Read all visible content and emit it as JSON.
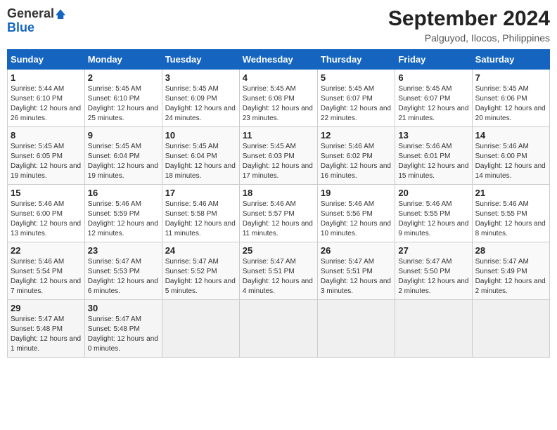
{
  "header": {
    "logo_line1": "General",
    "logo_line2": "Blue",
    "title": "September 2024",
    "subtitle": "Palguyod, Ilocos, Philippines"
  },
  "weekdays": [
    "Sunday",
    "Monday",
    "Tuesday",
    "Wednesday",
    "Thursday",
    "Friday",
    "Saturday"
  ],
  "weeks": [
    [
      {
        "day": "1",
        "sunrise": "5:44 AM",
        "sunset": "6:10 PM",
        "daylight": "12 hours and 26 minutes."
      },
      {
        "day": "2",
        "sunrise": "5:45 AM",
        "sunset": "6:10 PM",
        "daylight": "12 hours and 25 minutes."
      },
      {
        "day": "3",
        "sunrise": "5:45 AM",
        "sunset": "6:09 PM",
        "daylight": "12 hours and 24 minutes."
      },
      {
        "day": "4",
        "sunrise": "5:45 AM",
        "sunset": "6:08 PM",
        "daylight": "12 hours and 23 minutes."
      },
      {
        "day": "5",
        "sunrise": "5:45 AM",
        "sunset": "6:07 PM",
        "daylight": "12 hours and 22 minutes."
      },
      {
        "day": "6",
        "sunrise": "5:45 AM",
        "sunset": "6:07 PM",
        "daylight": "12 hours and 21 minutes."
      },
      {
        "day": "7",
        "sunrise": "5:45 AM",
        "sunset": "6:06 PM",
        "daylight": "12 hours and 20 minutes."
      }
    ],
    [
      {
        "day": "8",
        "sunrise": "5:45 AM",
        "sunset": "6:05 PM",
        "daylight": "12 hours and 19 minutes."
      },
      {
        "day": "9",
        "sunrise": "5:45 AM",
        "sunset": "6:04 PM",
        "daylight": "12 hours and 19 minutes."
      },
      {
        "day": "10",
        "sunrise": "5:45 AM",
        "sunset": "6:04 PM",
        "daylight": "12 hours and 18 minutes."
      },
      {
        "day": "11",
        "sunrise": "5:45 AM",
        "sunset": "6:03 PM",
        "daylight": "12 hours and 17 minutes."
      },
      {
        "day": "12",
        "sunrise": "5:46 AM",
        "sunset": "6:02 PM",
        "daylight": "12 hours and 16 minutes."
      },
      {
        "day": "13",
        "sunrise": "5:46 AM",
        "sunset": "6:01 PM",
        "daylight": "12 hours and 15 minutes."
      },
      {
        "day": "14",
        "sunrise": "5:46 AM",
        "sunset": "6:00 PM",
        "daylight": "12 hours and 14 minutes."
      }
    ],
    [
      {
        "day": "15",
        "sunrise": "5:46 AM",
        "sunset": "6:00 PM",
        "daylight": "12 hours and 13 minutes."
      },
      {
        "day": "16",
        "sunrise": "5:46 AM",
        "sunset": "5:59 PM",
        "daylight": "12 hours and 12 minutes."
      },
      {
        "day": "17",
        "sunrise": "5:46 AM",
        "sunset": "5:58 PM",
        "daylight": "12 hours and 11 minutes."
      },
      {
        "day": "18",
        "sunrise": "5:46 AM",
        "sunset": "5:57 PM",
        "daylight": "12 hours and 11 minutes."
      },
      {
        "day": "19",
        "sunrise": "5:46 AM",
        "sunset": "5:56 PM",
        "daylight": "12 hours and 10 minutes."
      },
      {
        "day": "20",
        "sunrise": "5:46 AM",
        "sunset": "5:55 PM",
        "daylight": "12 hours and 9 minutes."
      },
      {
        "day": "21",
        "sunrise": "5:46 AM",
        "sunset": "5:55 PM",
        "daylight": "12 hours and 8 minutes."
      }
    ],
    [
      {
        "day": "22",
        "sunrise": "5:46 AM",
        "sunset": "5:54 PM",
        "daylight": "12 hours and 7 minutes."
      },
      {
        "day": "23",
        "sunrise": "5:47 AM",
        "sunset": "5:53 PM",
        "daylight": "12 hours and 6 minutes."
      },
      {
        "day": "24",
        "sunrise": "5:47 AM",
        "sunset": "5:52 PM",
        "daylight": "12 hours and 5 minutes."
      },
      {
        "day": "25",
        "sunrise": "5:47 AM",
        "sunset": "5:51 PM",
        "daylight": "12 hours and 4 minutes."
      },
      {
        "day": "26",
        "sunrise": "5:47 AM",
        "sunset": "5:51 PM",
        "daylight": "12 hours and 3 minutes."
      },
      {
        "day": "27",
        "sunrise": "5:47 AM",
        "sunset": "5:50 PM",
        "daylight": "12 hours and 2 minutes."
      },
      {
        "day": "28",
        "sunrise": "5:47 AM",
        "sunset": "5:49 PM",
        "daylight": "12 hours and 2 minutes."
      }
    ],
    [
      {
        "day": "29",
        "sunrise": "5:47 AM",
        "sunset": "5:48 PM",
        "daylight": "12 hours and 1 minute."
      },
      {
        "day": "30",
        "sunrise": "5:47 AM",
        "sunset": "5:48 PM",
        "daylight": "12 hours and 0 minutes."
      },
      null,
      null,
      null,
      null,
      null
    ]
  ]
}
